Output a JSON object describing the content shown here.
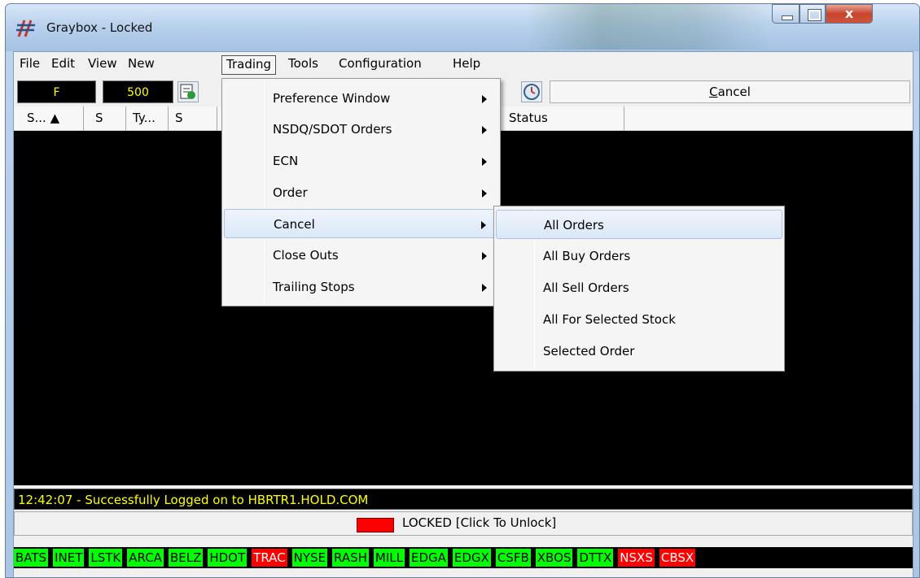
{
  "window": {
    "title": "Graybox - Locked",
    "close_glyph": "x"
  },
  "menubar": [
    "File",
    "Edit",
    "View",
    "New",
    "Trading",
    "Tools",
    "Configuration",
    "Help"
  ],
  "toolbar": {
    "symbol": "F",
    "quantity": "500",
    "cancel_label": "ancel",
    "cancel_mnemonic": "C"
  },
  "columns": [
    "S... ▲",
    "S",
    "Ty...",
    "S",
    "Status"
  ],
  "trading_menu": {
    "items": [
      {
        "label": "Preference Window",
        "submenu": true
      },
      {
        "label": "NSDQ/SDOT Orders",
        "submenu": true
      },
      {
        "label": "ECN",
        "submenu": true
      },
      {
        "label": "Order",
        "submenu": true
      },
      {
        "label": "Cancel",
        "submenu": true,
        "highlighted": true
      },
      {
        "label": "Close Outs",
        "submenu": true
      },
      {
        "label": "Trailing Stops",
        "submenu": true
      }
    ]
  },
  "cancel_submenu": {
    "items": [
      {
        "label": "All Orders",
        "highlighted": true
      },
      {
        "label": "All Buy Orders"
      },
      {
        "label": "All Sell Orders"
      },
      {
        "label": "All For Selected Stock"
      },
      {
        "label": "Selected Order"
      }
    ]
  },
  "status_line": "12:42:07 - Successfully Logged on to HBRTR1.HOLD.COM",
  "lock_bar": {
    "label": "LOCKED [Click To Unlock]",
    "indicator_color": "#ff0000"
  },
  "ecn_routes": [
    {
      "name": "BATS",
      "status": "green"
    },
    {
      "name": "INET",
      "status": "green"
    },
    {
      "name": "LSTK",
      "status": "green"
    },
    {
      "name": "ARCA",
      "status": "green"
    },
    {
      "name": "BELZ",
      "status": "green"
    },
    {
      "name": "HDOT",
      "status": "green"
    },
    {
      "name": "TRAC",
      "status": "red"
    },
    {
      "name": "NYSE",
      "status": "green"
    },
    {
      "name": "RASH",
      "status": "green"
    },
    {
      "name": "MILL",
      "status": "green"
    },
    {
      "name": "EDGA",
      "status": "green"
    },
    {
      "name": "EDGX",
      "status": "green"
    },
    {
      "name": "CSFB",
      "status": "green"
    },
    {
      "name": "XBOS",
      "status": "green"
    },
    {
      "name": "DTTX",
      "status": "green"
    },
    {
      "name": "NSXS",
      "status": "red"
    },
    {
      "name": "CBSX",
      "status": "red"
    }
  ],
  "colors": {
    "ticker_yellow": "#ffff00",
    "route_up": "#00ff00",
    "route_down": "#ff0000"
  }
}
